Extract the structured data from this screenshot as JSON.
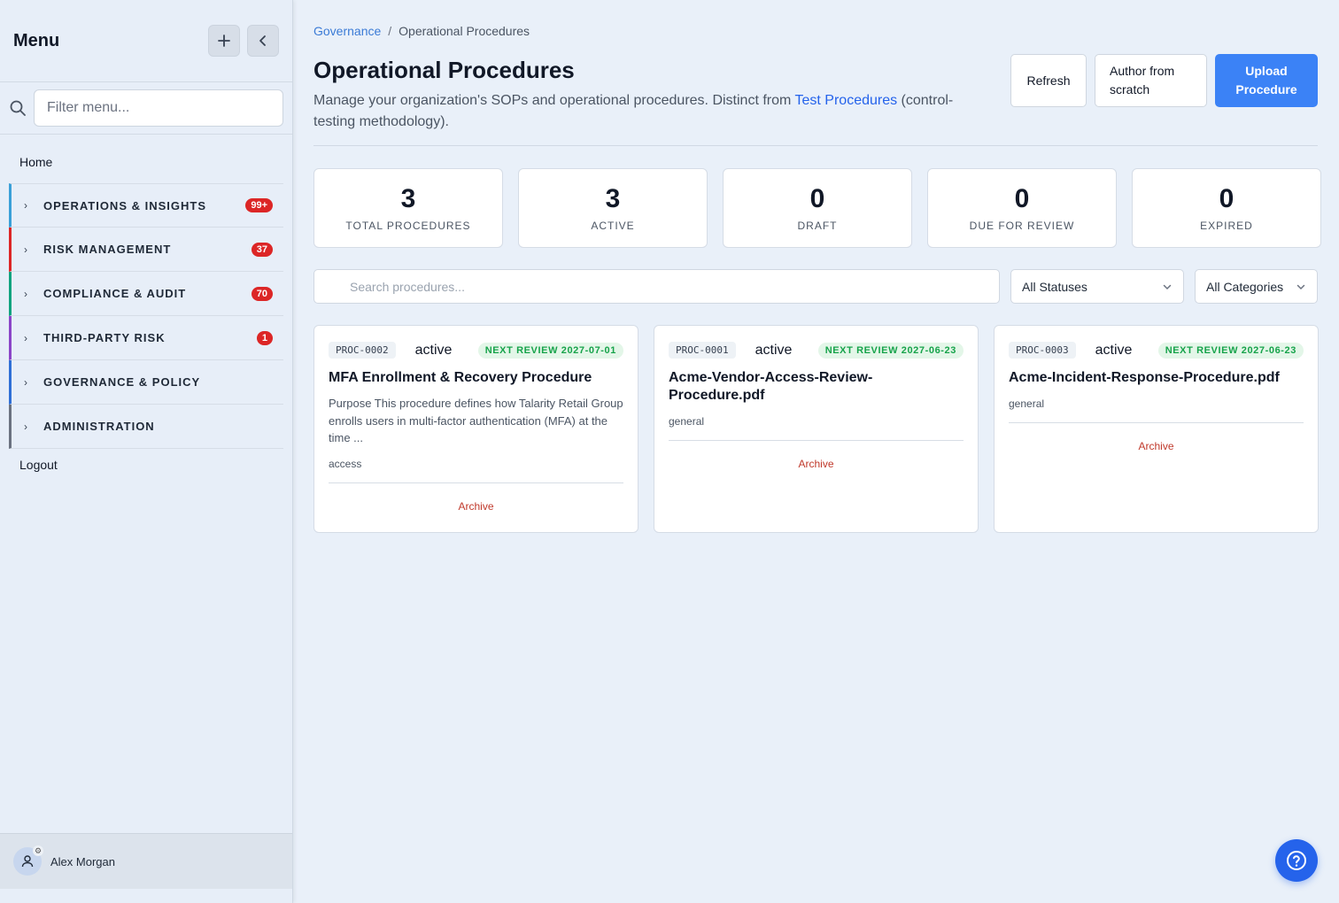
{
  "sidebar": {
    "title": "Menu",
    "filter_placeholder": "Filter menu...",
    "home": "Home",
    "logout": "Logout",
    "items": [
      {
        "label": "OPERATIONS & INSIGHTS",
        "badge": "99+",
        "color": "#3aa0d8"
      },
      {
        "label": "RISK MANAGEMENT",
        "badge": "37",
        "color": "#dc2626"
      },
      {
        "label": "COMPLIANCE & AUDIT",
        "badge": "70",
        "color": "#10a37f"
      },
      {
        "label": "THIRD-PARTY RISK",
        "badge": "1",
        "color": "#8b45c8"
      },
      {
        "label": "GOVERNANCE & POLICY",
        "badge": "",
        "color": "#2f6fd6"
      },
      {
        "label": "ADMINISTRATION",
        "badge": "",
        "color": "#6b7280"
      }
    ],
    "user": {
      "name": "Alex Morgan"
    }
  },
  "breadcrumb": {
    "parent": "Governance",
    "separator": "/",
    "current": "Operational Procedures"
  },
  "page": {
    "title": "Operational Procedures",
    "desc_prefix": "Manage your organization's SOPs and operational procedures. Distinct from ",
    "desc_link": "Test Procedures",
    "desc_suffix": " (control-testing methodology)."
  },
  "actions": {
    "refresh": "Refresh",
    "author": "Author from scratch",
    "upload": "Upload Procedure"
  },
  "stats": [
    {
      "value": "3",
      "label": "TOTAL PROCEDURES"
    },
    {
      "value": "3",
      "label": "ACTIVE"
    },
    {
      "value": "0",
      "label": "DRAFT"
    },
    {
      "value": "0",
      "label": "DUE FOR REVIEW"
    },
    {
      "value": "0",
      "label": "EXPIRED"
    }
  ],
  "filters": {
    "search_placeholder": "Search procedures...",
    "status": "All Statuses",
    "category": "All Categories"
  },
  "cards": [
    {
      "code": "PROC-0002",
      "status": "active",
      "review": "NEXT REVIEW 2027-07-01",
      "title": "MFA Enrollment & Recovery Procedure",
      "desc": "Purpose This procedure defines how Talarity Retail Group enrolls users in multi-factor authentication (MFA) at the time ...",
      "category": "access",
      "action": "Archive"
    },
    {
      "code": "PROC-0001",
      "status": "active",
      "review": "NEXT REVIEW 2027-06-23",
      "title": "Acme-Vendor-Access-Review-Procedure.pdf",
      "desc": "",
      "category": "general",
      "action": "Archive"
    },
    {
      "code": "PROC-0003",
      "status": "active",
      "review": "NEXT REVIEW 2027-06-23",
      "title": "Acme-Incident-Response-Procedure.pdf",
      "desc": "",
      "category": "general",
      "action": "Archive"
    }
  ]
}
